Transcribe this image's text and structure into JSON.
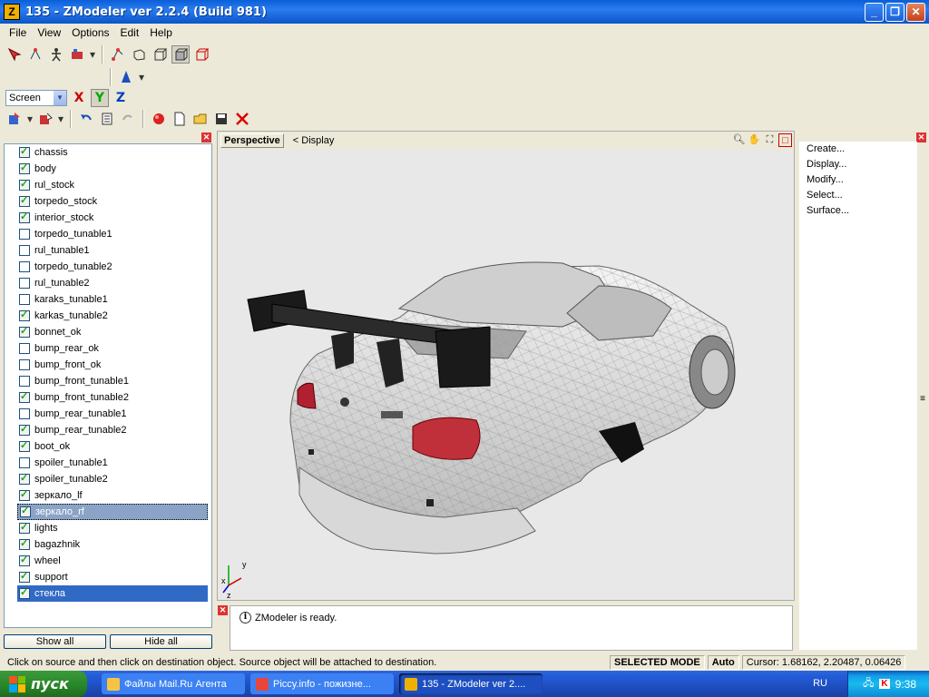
{
  "window": {
    "title": "135 - ZModeler ver 2.2.4 (Build 981)",
    "icon_letter": "Z",
    "min_label": "_",
    "max_label": "❐",
    "close_label": "✕"
  },
  "menu": [
    "File",
    "View",
    "Options",
    "Edit",
    "Help"
  ],
  "toolbar": {
    "mode_select": "Screen",
    "axis_x": "X",
    "axis_y": "Y",
    "axis_z": "Z"
  },
  "objects": [
    {
      "name": "chassis",
      "checked": true
    },
    {
      "name": "body",
      "checked": true
    },
    {
      "name": "rul_stock",
      "checked": true
    },
    {
      "name": "torpedo_stock",
      "checked": true
    },
    {
      "name": "interior_stock",
      "checked": true
    },
    {
      "name": "torpedo_tunable1",
      "checked": false
    },
    {
      "name": "rul_tunable1",
      "checked": false
    },
    {
      "name": "torpedo_tunable2",
      "checked": false
    },
    {
      "name": "rul_tunable2",
      "checked": false
    },
    {
      "name": "karaks_tunable1",
      "checked": false
    },
    {
      "name": "karkas_tunable2",
      "checked": true
    },
    {
      "name": "bonnet_ok",
      "checked": true
    },
    {
      "name": "bump_rear_ok",
      "checked": false
    },
    {
      "name": "bump_front_ok",
      "checked": false
    },
    {
      "name": "bump_front_tunable1",
      "checked": false
    },
    {
      "name": "bump_front_tunable2",
      "checked": true
    },
    {
      "name": "bump_rear_tunable1",
      "checked": false
    },
    {
      "name": "bump_rear_tunable2",
      "checked": true
    },
    {
      "name": "boot_ok",
      "checked": true
    },
    {
      "name": "spoiler_tunable1",
      "checked": false
    },
    {
      "name": "spoiler_tunable2",
      "checked": true
    },
    {
      "name": "зеркало_lf",
      "checked": true
    },
    {
      "name": "зеркало_rf",
      "checked": true,
      "state": "selected-gray"
    },
    {
      "name": "lights",
      "checked": true
    },
    {
      "name": "bagazhnik",
      "checked": true
    },
    {
      "name": "wheel",
      "checked": true
    },
    {
      "name": "support",
      "checked": true
    },
    {
      "name": "стекла",
      "checked": true,
      "state": "selected-blue"
    }
  ],
  "left_buttons": {
    "show_all": "Show all",
    "hide_all": "Hide all"
  },
  "viewport": {
    "tab": "Perspective",
    "display_label": "<  Display",
    "gizmo_y": "y",
    "gizmo_x": "x",
    "gizmo_z": "z"
  },
  "log": {
    "message": "ZModeler is ready."
  },
  "commands": [
    "Create...",
    "Display...",
    "Modify...",
    "Select...",
    "Surface..."
  ],
  "status": {
    "message": "Click on source and then click on destination object. Source object will be attached to destination.",
    "mode": "SELECTED MODE",
    "auto": "Auto",
    "cursor": "Cursor: 1.68162, 2.20487, 0.06426"
  },
  "taskbar": {
    "start": "пуск",
    "tasks": [
      {
        "label": "Файлы Mail.Ru Агента",
        "color": "#f6c343"
      },
      {
        "label": "Piccy.info - пожизне...",
        "color": "#e8453c"
      },
      {
        "label": "135 - ZModeler ver 2....",
        "color": "#f0b000",
        "active": true
      }
    ],
    "lang": "RU",
    "time": "9:38"
  }
}
